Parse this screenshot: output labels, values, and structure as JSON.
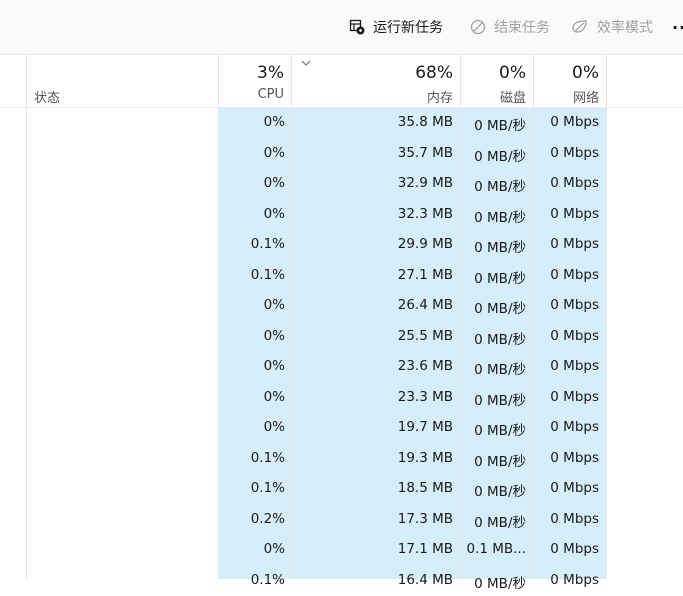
{
  "toolbar": {
    "run_new_task": "运行新任务",
    "end_task": "结束任务",
    "efficiency_mode": "效率模式",
    "more": "···"
  },
  "columns": {
    "status": {
      "label": "状态"
    },
    "cpu": {
      "percent": "3%",
      "label": "CPU"
    },
    "memory": {
      "percent": "68%",
      "label": "内存"
    },
    "disk": {
      "percent": "0%",
      "label": "磁盘"
    },
    "network": {
      "percent": "0%",
      "label": "网络"
    }
  },
  "rows": [
    {
      "cpu": "0%",
      "memory": "35.8 MB",
      "disk": "0 MB/秒",
      "network": "0 Mbps"
    },
    {
      "cpu": "0%",
      "memory": "35.7 MB",
      "disk": "0 MB/秒",
      "network": "0 Mbps"
    },
    {
      "cpu": "0%",
      "memory": "32.9 MB",
      "disk": "0 MB/秒",
      "network": "0 Mbps"
    },
    {
      "cpu": "0%",
      "memory": "32.3 MB",
      "disk": "0 MB/秒",
      "network": "0 Mbps"
    },
    {
      "cpu": "0.1%",
      "memory": "29.9 MB",
      "disk": "0 MB/秒",
      "network": "0 Mbps"
    },
    {
      "cpu": "0.1%",
      "memory": "27.1 MB",
      "disk": "0 MB/秒",
      "network": "0 Mbps"
    },
    {
      "cpu": "0%",
      "memory": "26.4 MB",
      "disk": "0 MB/秒",
      "network": "0 Mbps"
    },
    {
      "cpu": "0%",
      "memory": "25.5 MB",
      "disk": "0 MB/秒",
      "network": "0 Mbps"
    },
    {
      "cpu": "0%",
      "memory": "23.6 MB",
      "disk": "0 MB/秒",
      "network": "0 Mbps"
    },
    {
      "cpu": "0%",
      "memory": "23.3 MB",
      "disk": "0 MB/秒",
      "network": "0 Mbps"
    },
    {
      "cpu": "0%",
      "memory": "19.7 MB",
      "disk": "0 MB/秒",
      "network": "0 Mbps"
    },
    {
      "cpu": "0.1%",
      "memory": "19.3 MB",
      "disk": "0 MB/秒",
      "network": "0 Mbps"
    },
    {
      "cpu": "0.1%",
      "memory": "18.5 MB",
      "disk": "0 MB/秒",
      "network": "0 Mbps"
    },
    {
      "cpu": "0.2%",
      "memory": "17.3 MB",
      "disk": "0 MB/秒",
      "network": "0 Mbps"
    },
    {
      "cpu": "0%",
      "memory": "17.1 MB",
      "disk": "0.1 MB...",
      "network": "0 Mbps"
    },
    {
      "cpu": "0.1%",
      "memory": "16.4 MB",
      "disk": "0 MB/秒",
      "network": "0 Mbps"
    }
  ]
}
